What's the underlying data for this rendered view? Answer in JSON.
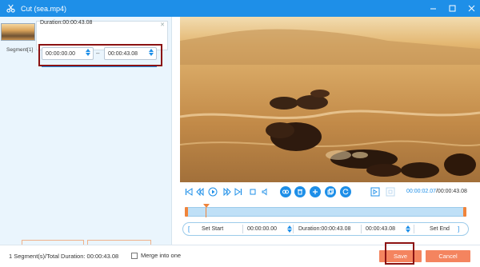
{
  "window": {
    "title": "Cut (sea.mp4)"
  },
  "segment_panel": {
    "duration_label": "Duration:00:00:43.08",
    "segment_label": "Segment[1]",
    "start_time": "00:00:00.00",
    "end_time": "00:00:43.08",
    "add_segment": "Add Segment",
    "fast_split": "Fast Split"
  },
  "player": {
    "current_time": "00:00:02.07",
    "total_time": "/00:00:43.08",
    "progress_fraction": 0.07
  },
  "set_bar": {
    "set_start": "Set Start",
    "start_value": "00:00:00.00",
    "duration": "Duration:00:00:43.08",
    "end_value": "00:00:43.08",
    "set_end": "Set End"
  },
  "footer": {
    "summary": "1 Segment(s)/Total Duration: 00:00:43.08",
    "merge_label": "Merge into one",
    "save": "Save",
    "cancel": "Cancel"
  },
  "colors": {
    "accent": "#1e8fe8",
    "orange": "#f4845f",
    "highlight": "#8b1212"
  }
}
